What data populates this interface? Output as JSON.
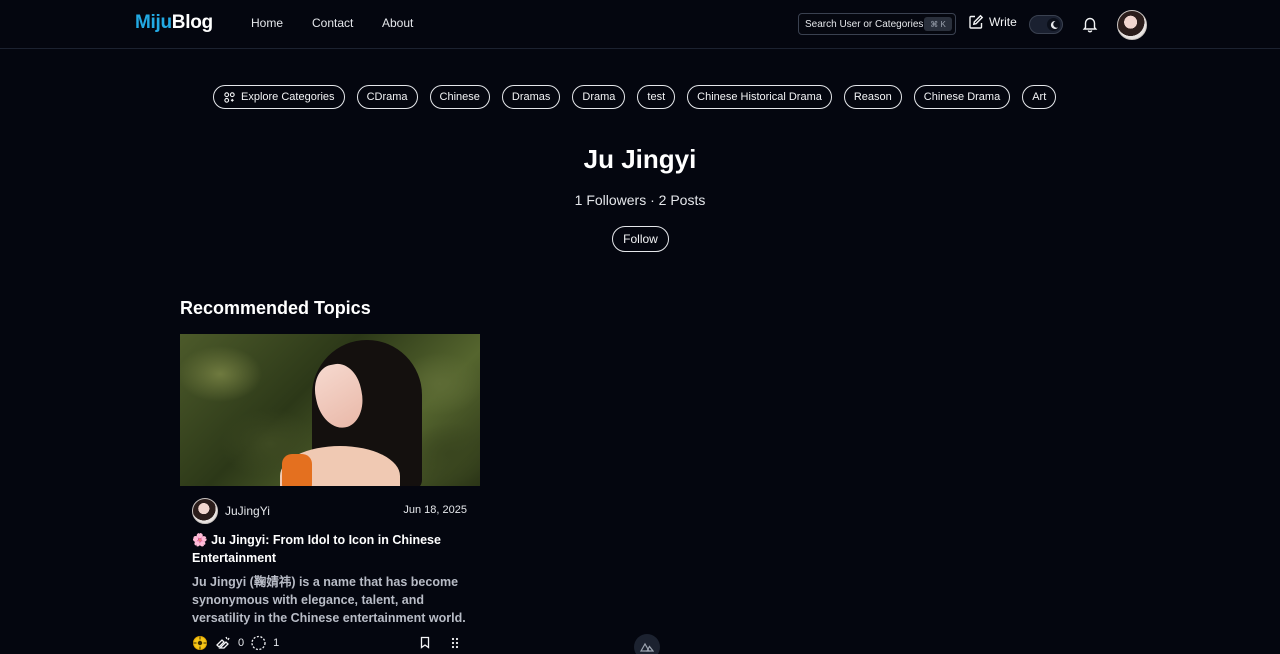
{
  "header": {
    "logo_part1": "Miju",
    "logo_part2": "Blog",
    "nav": [
      "Home",
      "Contact",
      "About"
    ],
    "search_placeholder": "Search User or Categories...",
    "search_shortcut": "⌘ K",
    "write_label": "Write",
    "theme": "dark"
  },
  "categories": {
    "explore_label": "Explore Categories",
    "items": [
      "CDrama",
      "Chinese",
      "Dramas",
      "Drama",
      "test",
      "Chinese Historical Drama",
      "Reason",
      "Chinese Drama",
      "Art"
    ]
  },
  "profile": {
    "name": "Ju Jingyi",
    "stats": "1 Followers · 2 Posts",
    "follow_label": "Follow"
  },
  "recommended": {
    "title": "Recommended Topics",
    "posts": [
      {
        "author": "JuJingYi",
        "date": "Jun 18, 2025",
        "title_emoji": "🌸",
        "title": "Ju Jingyi: From Idol to Icon in Chinese Entertainment",
        "excerpt": "Ju Jingyi (鞠婧祎) is a name that has become synonymous with elegance, talent, and versatility in the Chinese entertainment world.",
        "reactions": "0",
        "comments": "1"
      }
    ]
  },
  "colors": {
    "background": "#04060f",
    "accent": "#22a9e3"
  }
}
